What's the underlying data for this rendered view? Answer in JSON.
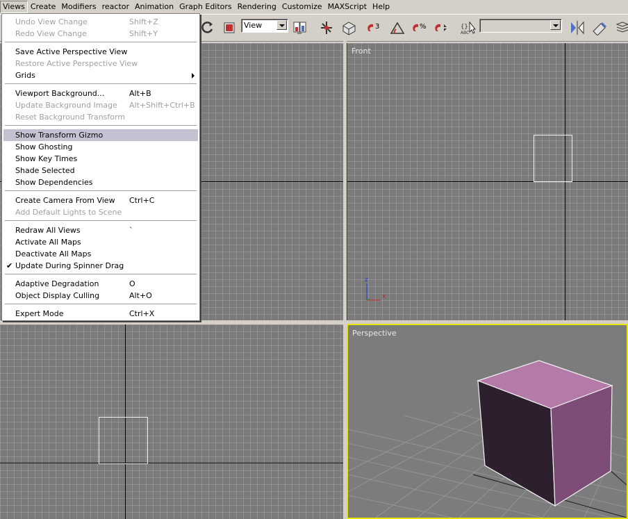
{
  "menubar": {
    "items": [
      "Views",
      "Create",
      "Modifiers",
      "reactor",
      "Animation",
      "Graph Editors",
      "Rendering",
      "Customize",
      "MAXScript",
      "Help"
    ]
  },
  "toolbar": {
    "view_combo": "View",
    "selection_set_combo": ""
  },
  "views_menu": {
    "items": [
      {
        "label": "Undo View Change",
        "shortcut": "Shift+Z",
        "disabled": true
      },
      {
        "label": "Redo View Change",
        "shortcut": "Shift+Y",
        "disabled": true
      },
      {
        "label": "Save Active Perspective View",
        "shortcut": "",
        "disabled": false
      },
      {
        "label": "Restore Active Perspective View",
        "shortcut": "",
        "disabled": true
      },
      {
        "label": "Grids",
        "shortcut": "",
        "disabled": false,
        "submenu": true
      },
      {
        "label": "Viewport Background...",
        "shortcut": "Alt+B",
        "disabled": false
      },
      {
        "label": "Update Background Image",
        "shortcut": "Alt+Shift+Ctrl+B",
        "disabled": true
      },
      {
        "label": "Reset Background Transform",
        "shortcut": "",
        "disabled": true
      },
      {
        "label": "Show Transform Gizmo",
        "shortcut": "",
        "disabled": false,
        "highlighted": true
      },
      {
        "label": "Show Ghosting",
        "shortcut": "",
        "disabled": false
      },
      {
        "label": "Show Key Times",
        "shortcut": "",
        "disabled": false
      },
      {
        "label": "Shade Selected",
        "shortcut": "",
        "disabled": false
      },
      {
        "label": "Show Dependencies",
        "shortcut": "",
        "disabled": false
      },
      {
        "label": "Create Camera From View",
        "shortcut": "Ctrl+C",
        "disabled": false
      },
      {
        "label": "Add Default Lights to Scene",
        "shortcut": "",
        "disabled": true
      },
      {
        "label": "Redraw All Views",
        "shortcut": "`",
        "disabled": false
      },
      {
        "label": "Activate All Maps",
        "shortcut": "",
        "disabled": false
      },
      {
        "label": "Deactivate All Maps",
        "shortcut": "",
        "disabled": false
      },
      {
        "label": "Update During Spinner Drag",
        "shortcut": "",
        "disabled": false,
        "checked": true
      },
      {
        "label": "Adaptive Degradation",
        "shortcut": "O",
        "disabled": false
      },
      {
        "label": "Object Display Culling",
        "shortcut": "Alt+O",
        "disabled": false
      },
      {
        "label": "Expert Mode",
        "shortcut": "Ctrl+X",
        "disabled": false
      }
    ]
  },
  "viewports": {
    "front_label": "Front",
    "perspective_label": "Perspective",
    "axis_z": "z",
    "axis_x": "x"
  },
  "colors": {
    "active_viewport_border": "#e6e600",
    "cube_top": "#b47aa8",
    "cube_front": "#2e1f2e",
    "cube_side": "#7d4d78",
    "menu_highlight": "#c4c1d2"
  }
}
